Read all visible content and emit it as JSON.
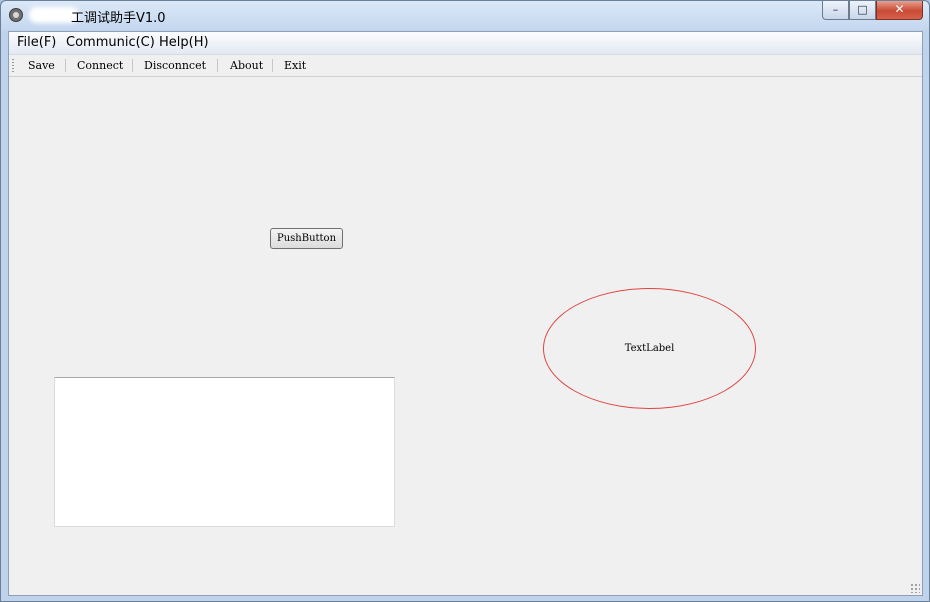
{
  "window": {
    "title": "工调试助手V1.0",
    "controls": {
      "minimize": "–",
      "maximize": "□",
      "close": "✕"
    }
  },
  "menubar": {
    "items": [
      {
        "label": "File(F)"
      },
      {
        "label": "Communic(C)"
      },
      {
        "label": "Help(H)"
      }
    ]
  },
  "toolbar": {
    "items": [
      {
        "label": "Save"
      },
      {
        "label": "Connect"
      },
      {
        "label": "Disconncet"
      },
      {
        "label": "About"
      },
      {
        "label": "Exit"
      }
    ]
  },
  "content": {
    "push_button_label": "PushButton",
    "ellipse_label_text": "TextLabel",
    "ellipse_border_color": "#e04444"
  },
  "icons": {
    "app": "app-icon",
    "resize": "resize-grip-icon"
  }
}
